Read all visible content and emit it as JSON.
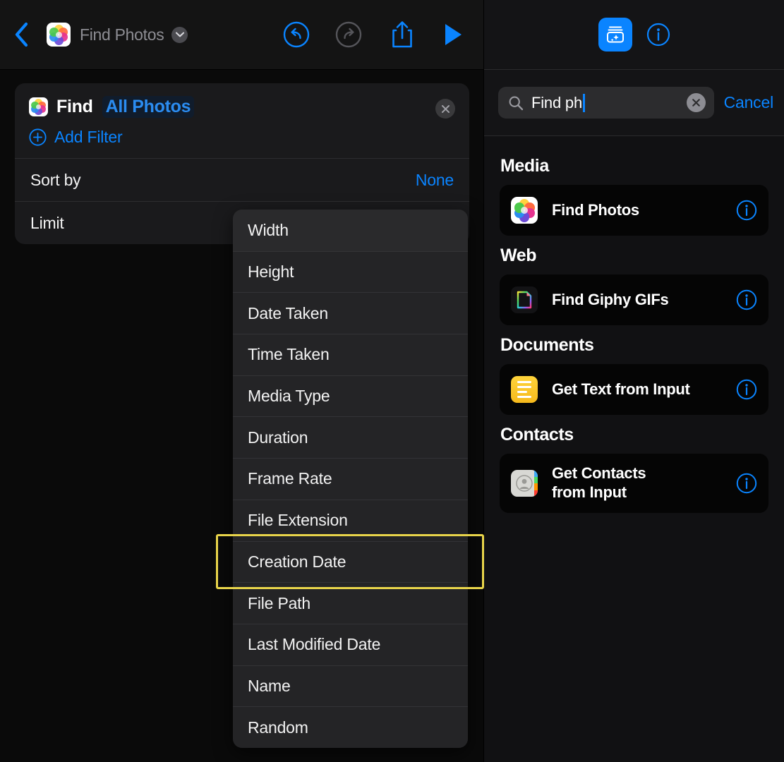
{
  "left": {
    "toolbar": {
      "back_icon": "chevron-left-icon",
      "app_icon": "photos-app-icon",
      "title": "Find Photos",
      "title_chevron_icon": "chevron-down-icon",
      "undo_icon": "undo-icon",
      "redo_icon": "redo-icon",
      "share_icon": "share-icon",
      "play_icon": "play-icon"
    },
    "find_card": {
      "icon": "photos-app-icon",
      "action_label": "Find",
      "token_label": "All Photos",
      "close_icon": "close-circle-icon",
      "add_filter_icon": "plus-circle-icon",
      "add_filter_label": "Add Filter",
      "rows": [
        {
          "key": "Sort by",
          "value": "None"
        },
        {
          "key": "Limit",
          "value": ""
        }
      ]
    },
    "menu": {
      "items": [
        "Width",
        "Height",
        "Date Taken",
        "Time Taken",
        "Media Type",
        "Duration",
        "Frame Rate",
        "File Extension",
        "Creation Date",
        "File Path",
        "Last Modified Date",
        "Name",
        "Random"
      ],
      "highlighted": "Creation Date",
      "highlight_color": "#e8d44a"
    }
  },
  "right": {
    "toolbar": {
      "library_icon": "shortcuts-library-icon",
      "info_icon": "info-circle-icon"
    },
    "search": {
      "search_icon": "search-icon",
      "value": "Find ph",
      "placeholder": "Search",
      "clear_icon": "clear-circle-icon",
      "cancel_label": "Cancel"
    },
    "sections": [
      {
        "title": "Media",
        "items": [
          {
            "name": "Find Photos",
            "icon": "photos-app-icon",
            "info_icon": "info-circle-icon"
          }
        ]
      },
      {
        "title": "Web",
        "items": [
          {
            "name": "Find Giphy GIFs",
            "icon": "giphy-app-icon",
            "info_icon": "info-circle-icon"
          }
        ]
      },
      {
        "title": "Documents",
        "items": [
          {
            "name": "Get Text from Input",
            "icon": "text-document-icon",
            "info_icon": "info-circle-icon"
          }
        ]
      },
      {
        "title": "Contacts",
        "items": [
          {
            "name": "Get Contacts\nfrom Input",
            "icon": "contacts-app-icon",
            "info_icon": "info-circle-icon"
          }
        ]
      }
    ]
  },
  "colors": {
    "accent_blue": "#0a84ff",
    "highlight_yellow": "#e8d44a",
    "panel_bg": "#0a0a0a",
    "card_bg": "#1a1a1c",
    "menu_bg": "#242426"
  }
}
